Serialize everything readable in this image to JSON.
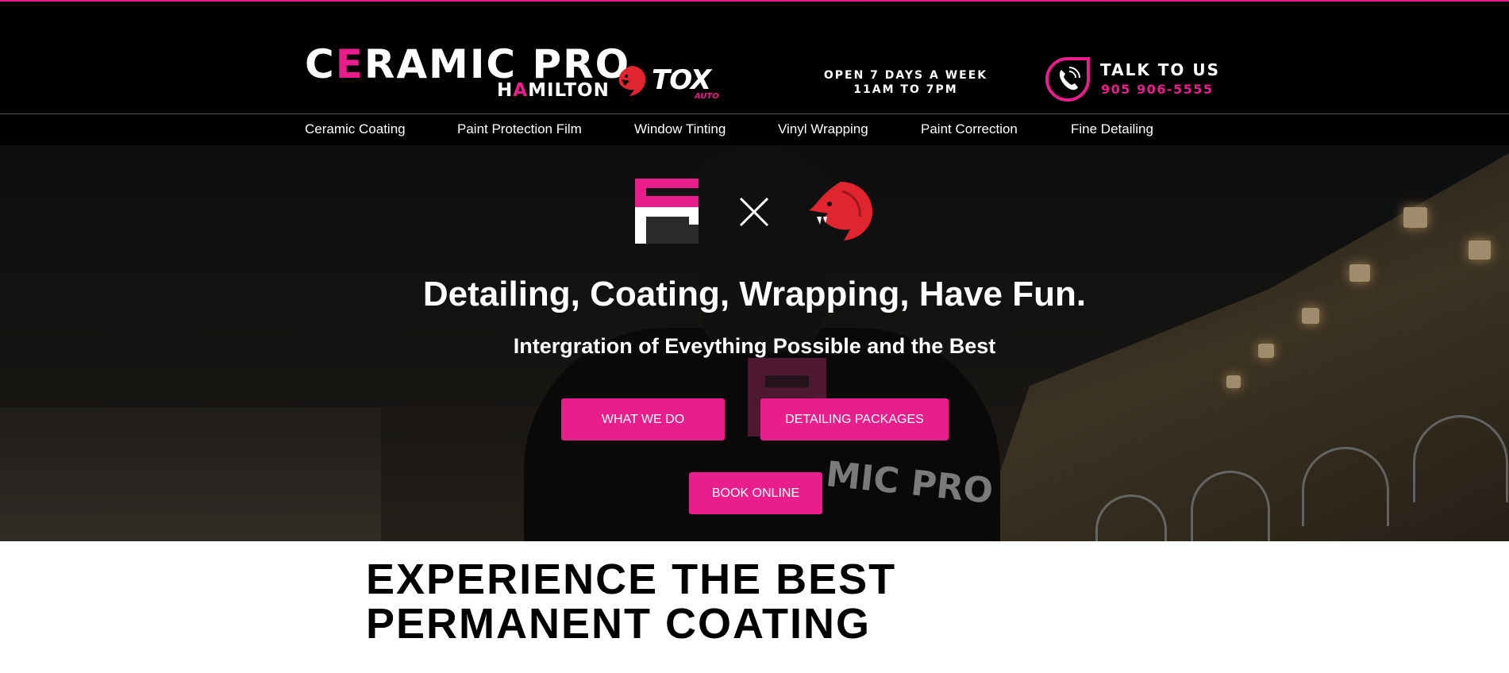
{
  "header": {
    "brand_main_prefix": "C",
    "brand_main_accent": "E",
    "brand_main_suffix": "RAMIC PRO",
    "brand_sub_prefix": "H",
    "brand_sub_accent": "A",
    "brand_sub_suffix": "MILTON",
    "partner_logo_text": "TOX",
    "partner_logo_subtext": "AUTO",
    "hours_line1": "OPEN 7 DAYS A WEEK",
    "hours_line2": "11AM TO 7PM",
    "contact_label": "TALK TO US",
    "contact_phone": "905 906-5555"
  },
  "nav": {
    "items": [
      {
        "label": "Ceramic Coating"
      },
      {
        "label": "Paint Protection Film"
      },
      {
        "label": "Window Tinting"
      },
      {
        "label": "Vinyl Wrapping"
      },
      {
        "label": "Paint Correction"
      },
      {
        "label": "Fine Detailing"
      }
    ]
  },
  "hero": {
    "title": "Detailing, Coating, Wrapping, Have Fun.",
    "subtitle": "Intergration of Eveything Possible and the Best",
    "jacket_text": "MIC PRO",
    "buttons": {
      "what_we_do": "WHAT WE DO",
      "packages": "DETAILING PACKAGES",
      "book": "BOOK ONLINE"
    }
  },
  "main": {
    "headline_line1": "EXPERIENCE THE BEST",
    "headline_line2": "PERMANENT COATING"
  },
  "colors": {
    "accent": "#e91e8c",
    "header_bg": "#000000",
    "text_light": "#ffffff"
  },
  "icons": {
    "phone": "phone-icon",
    "cross": "close-icon",
    "cobra": "cobra-logo-icon",
    "brand_mark": "ceramic-pro-mark-icon"
  }
}
